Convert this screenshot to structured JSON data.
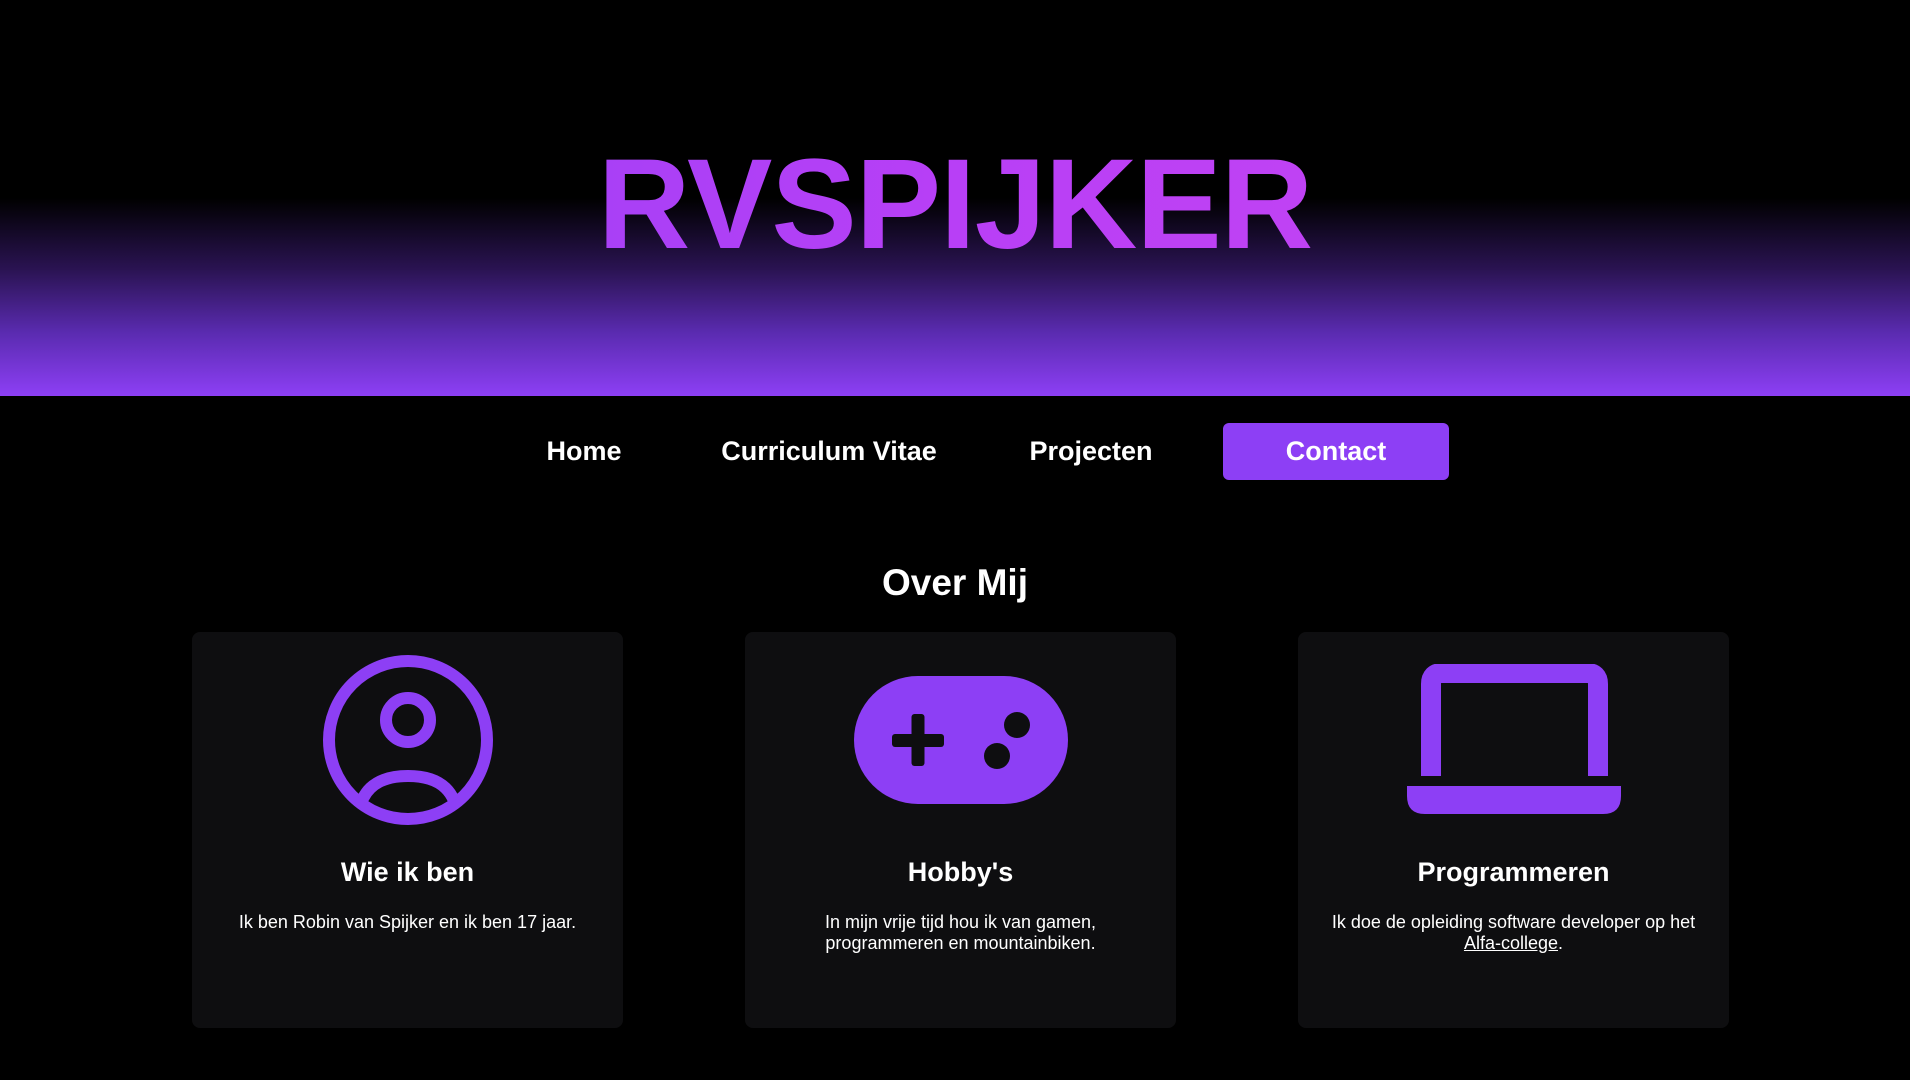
{
  "site": {
    "title": "RVSPIJKER"
  },
  "nav": {
    "items": [
      {
        "label": "Home"
      },
      {
        "label": "Curriculum Vitae"
      },
      {
        "label": "Projecten"
      },
      {
        "label": "Contact",
        "active": true
      }
    ]
  },
  "main": {
    "section_title": "Over Mij",
    "cards": [
      {
        "icon": "user-circle-icon",
        "title": "Wie ik ben",
        "text": "Ik ben Robin van Spijker en ik ben 17 jaar."
      },
      {
        "icon": "gamepad-icon",
        "title": "Hobby's",
        "text": "In mijn vrije tijd hou ik van gamen, programmeren en mountainbiken."
      },
      {
        "icon": "laptop-icon",
        "title": "Programmeren",
        "text_before": "Ik doe de opleiding software developer op het ",
        "link": "Alfa-college",
        "text_after": "."
      }
    ]
  },
  "colors": {
    "accent": "#8d3ff5",
    "title_gradient_end": "#cc47ef",
    "card_bg": "#0e0e10",
    "background": "#000000"
  }
}
